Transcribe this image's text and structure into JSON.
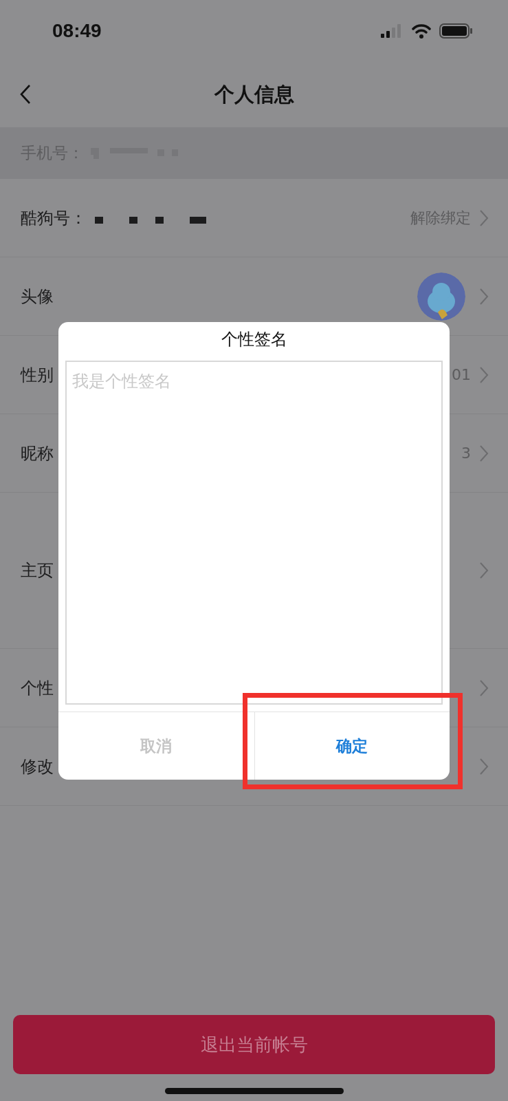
{
  "status_bar": {
    "time": "08:49"
  },
  "nav": {
    "title": "个人信息"
  },
  "rows": [
    {
      "kind": "phone",
      "label": "手机号："
    },
    {
      "kind": "link",
      "label": "酷狗号：",
      "masked": true,
      "value": "解除绑定"
    },
    {
      "kind": "avatar",
      "label": "头像"
    },
    {
      "kind": "link",
      "label": "性别",
      "value": "01"
    },
    {
      "kind": "link",
      "label": "昵称",
      "value": "3"
    },
    {
      "kind": "tall",
      "label": "主页"
    },
    {
      "kind": "link",
      "label": "个性"
    },
    {
      "kind": "link",
      "label": "修改"
    }
  ],
  "dialog": {
    "title": "个性签名",
    "placeholder": "我是个性签名",
    "buttons": [
      {
        "kind": "cancel",
        "label": "取消",
        "highlighted": false
      },
      {
        "kind": "confirm",
        "label": "确定",
        "highlighted": true
      }
    ]
  },
  "logout_button": {
    "label": "退出当前帐号"
  }
}
